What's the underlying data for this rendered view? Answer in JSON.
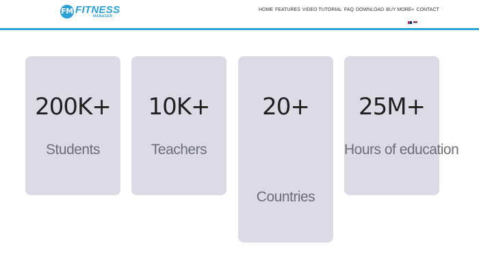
{
  "header": {
    "logo": {
      "badge": "FM",
      "title": "FITNESS",
      "subtitle": "MANAGER"
    },
    "nav": [
      "HOME",
      "FEATURES",
      "VIDEO TUTORIAL",
      "FAQ",
      "DOWNLOAD",
      "BUY MORE+",
      "CONTACT"
    ],
    "languages": [
      "flag-en-icon",
      "flag-rs-icon"
    ],
    "accent_color": "#2aa0d6"
  },
  "stats": [
    {
      "value": "200K+",
      "label": "Students"
    },
    {
      "value": "10K+",
      "label": "Teachers"
    },
    {
      "value": "20+",
      "label": "Countries"
    },
    {
      "value": "25M+",
      "label": "Hours of education"
    }
  ],
  "colors": {
    "card_background": "#dcdae4",
    "value_text": "#1f1f1f",
    "label_text": "#6d6d75"
  }
}
